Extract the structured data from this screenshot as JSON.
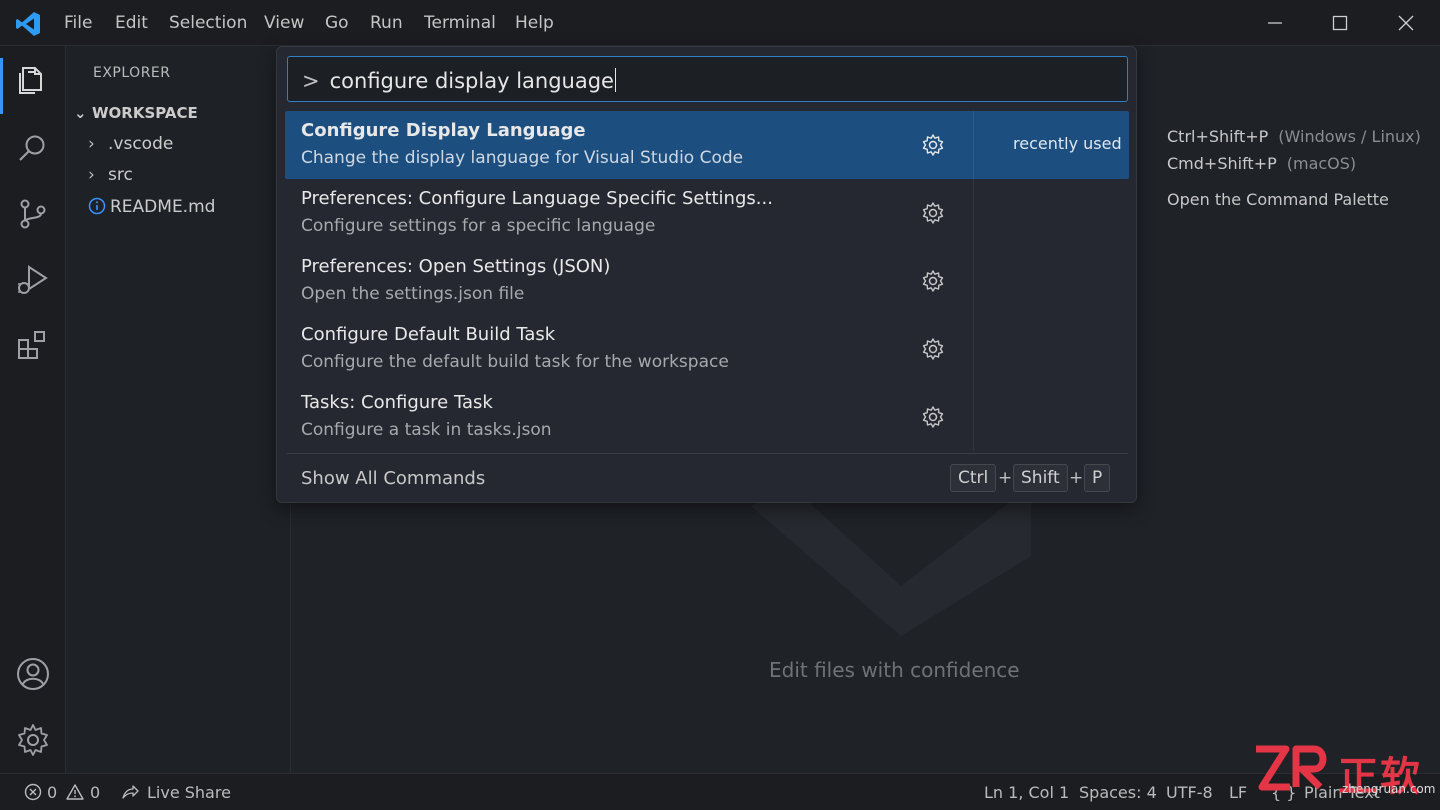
{
  "menu": [
    "File",
    "Edit",
    "Selection",
    "View",
    "Go",
    "Run",
    "Terminal",
    "Help"
  ],
  "icons": {
    "app": "vscode-logo-icon",
    "minimize": "minimize-icon",
    "maximize": "maximize-icon",
    "close": "close-icon"
  },
  "activitybar": {
    "items": [
      "explorer-icon",
      "search-icon",
      "source-control-icon",
      "run-debug-icon",
      "extensions-icon"
    ],
    "bottom": [
      "account-icon",
      "manage-gear-icon"
    ]
  },
  "sidebar": {
    "title": "EXPLORER",
    "workspace": "WORKSPACE",
    "items": [
      {
        "label": ".vscode",
        "icon": "chevron-right-icon"
      },
      {
        "label": "src",
        "icon": "chevron-right-icon"
      },
      {
        "label": "README.md",
        "icon": "info-icon"
      }
    ]
  },
  "palette": {
    "prompt": ">",
    "query": "configure display language",
    "results": [
      {
        "label": "Configure Display Language",
        "desc": "Change the display language for Visual Studio Code",
        "badge": "recently used",
        "selected": true
      },
      {
        "label": "Preferences: Configure Language Specific Settings...",
        "desc": "Configure settings for a specific language",
        "badge": "",
        "selected": false
      },
      {
        "label": "Preferences: Open Settings (JSON)",
        "desc": "Open the settings.json file",
        "badge": "",
        "selected": false
      },
      {
        "label": "Configure Default Build Task",
        "desc": "Configure the default build task for the workspace",
        "badge": "",
        "selected": false
      },
      {
        "label": "Tasks: Configure Task",
        "desc": "Configure a task in tasks.json",
        "badge": "",
        "selected": false
      }
    ],
    "footer": {
      "label": "Show All Commands",
      "keys": [
        "Ctrl",
        "Shift",
        "P"
      ],
      "plus": "+"
    }
  },
  "hints": {
    "shortcut_win": "Ctrl+Shift+P",
    "shortcut_win_note": "(Windows / Linux)",
    "shortcut_mac": "Cmd+Shift+P",
    "shortcut_mac_note": "(macOS)",
    "action": "Open the Command Palette"
  },
  "editor": {
    "tagline": "Edit files with confidence"
  },
  "statusbar": {
    "errors": "0",
    "warnings": "0",
    "live_share": "Live Share",
    "position": "Ln 1, Col 1",
    "spaces": "Spaces: 4",
    "encoding": "UTF-8",
    "eol": "LF",
    "braces": "{ }",
    "language": "Plain Text"
  },
  "brand": {
    "logo_text": "正软",
    "url": "zhengruan.com"
  },
  "colors": {
    "accent": "#3794ff",
    "selected_row": "#1c4f80",
    "input_border": "#2f7fc4",
    "background": "#1f2227"
  }
}
